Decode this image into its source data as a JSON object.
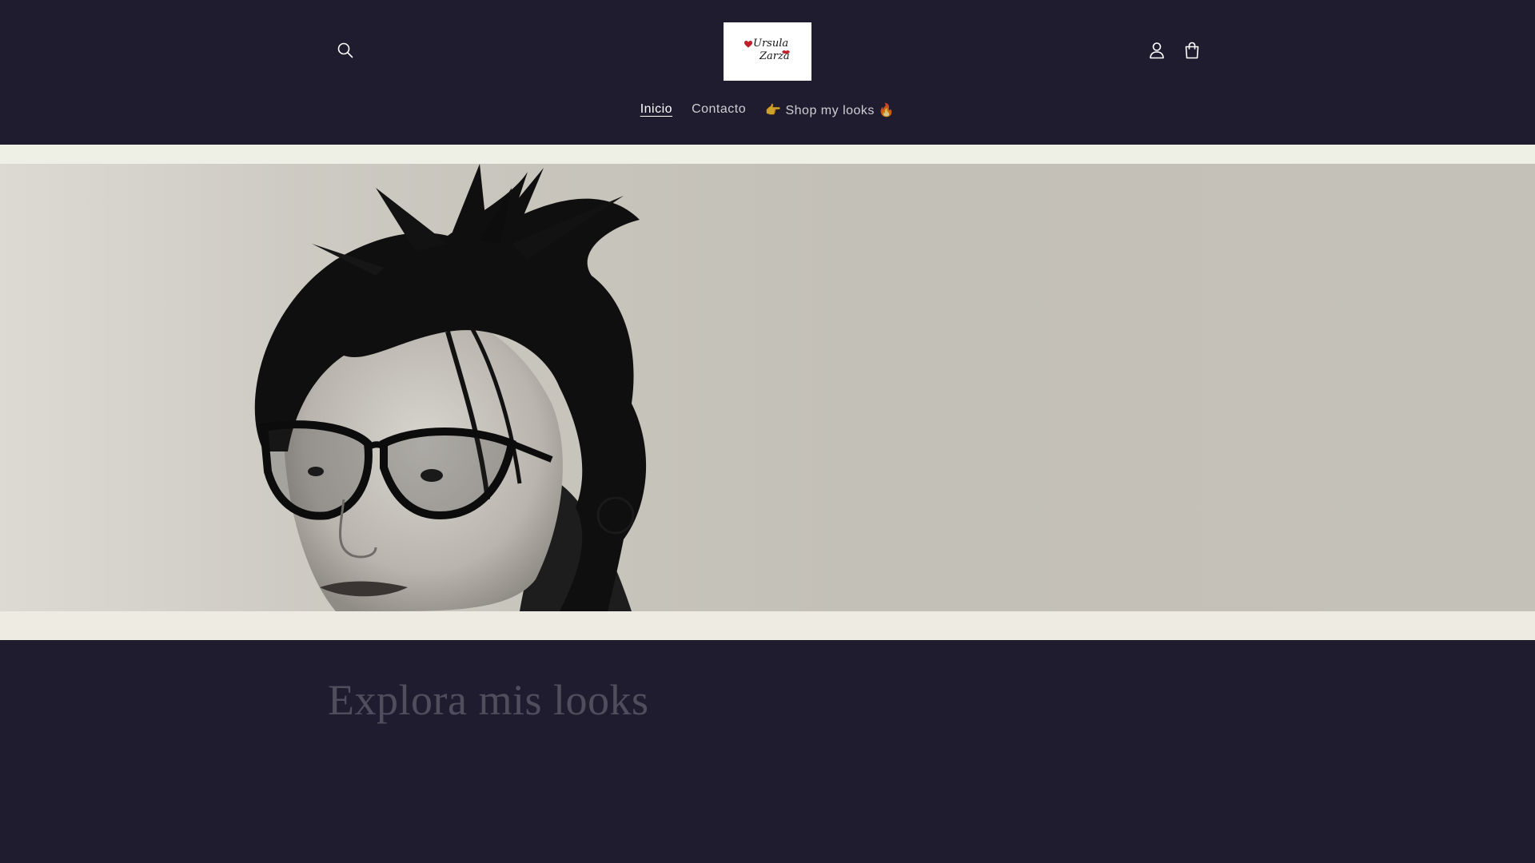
{
  "header": {
    "logo": {
      "line1": "Ursula",
      "line2": "Zarza"
    },
    "icons": {
      "search": "search-icon",
      "account": "user-icon",
      "cart": "shopping-bag-icon"
    },
    "nav": [
      {
        "label": "Inicio",
        "active": true
      },
      {
        "label": "Contacto",
        "active": false
      },
      {
        "label": "👉 Shop my looks 🔥",
        "active": false
      }
    ]
  },
  "hero": {
    "image": "portrait-woman-cat-eye-glasses"
  },
  "section": {
    "title": "Explora mis looks"
  },
  "colors": {
    "background": "#1f1c30",
    "banner_band": "#eef0e6",
    "banner_bg": "#c4c1b8",
    "logo_heart": "#c0202a"
  }
}
